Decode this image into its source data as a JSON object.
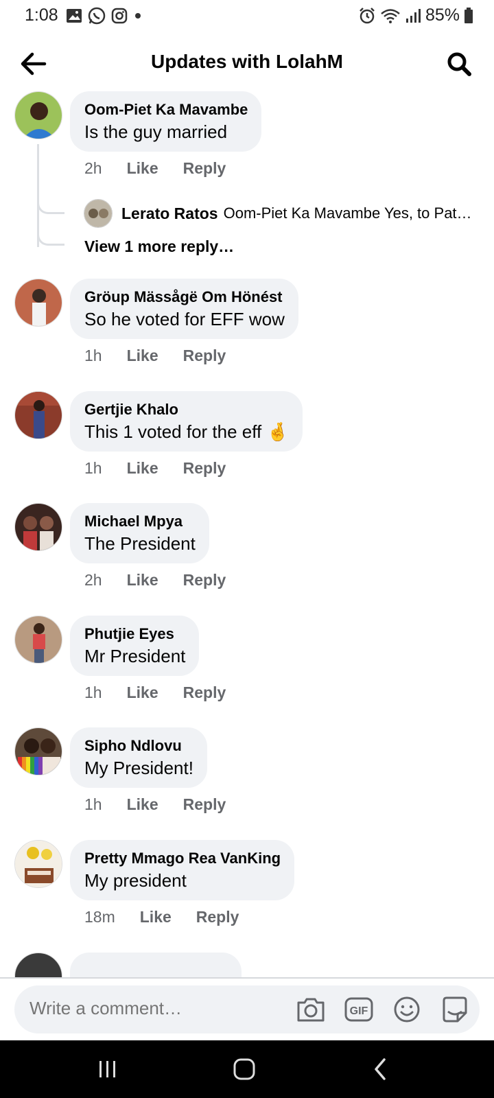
{
  "status": {
    "time": "1:08",
    "battery": "85%"
  },
  "header": {
    "title": "Updates with LolahM"
  },
  "actions": {
    "like": "Like",
    "reply": "Reply"
  },
  "comments": [
    {
      "name": "Oom-Piet Ka Mavambe",
      "text": "Is the guy married",
      "time": "2h",
      "avatar_color": "#6fa8d8",
      "replies": {
        "name": "Lerato Ratos",
        "text": "Oom-Piet Ka Mavambe Yes, to Pat…",
        "view_more": "View 1 more reply…"
      }
    },
    {
      "name": "Gröup Mässågë Om Hönést",
      "text": "So he voted for EFF wow",
      "time": "1h",
      "avatar_color": "#c0674a"
    },
    {
      "name": "Gertjie Khalo",
      "text": "This 1 voted for the eff 🤞",
      "time": "1h",
      "avatar_color": "#7a3b2e"
    },
    {
      "name": "Michael Mpya",
      "text": "The President",
      "time": "2h",
      "avatar_color": "#4a2a22"
    },
    {
      "name": "Phutjie Eyes",
      "text": "Mr President",
      "time": "1h",
      "avatar_color": "#a3684e"
    },
    {
      "name": "Sipho Ndlovu",
      "text": "My President!",
      "time": "1h",
      "avatar_color": "#5e4a3a"
    },
    {
      "name": "Pretty Mmago Rea VanKing",
      "text": "My president",
      "time": "18m",
      "avatar_color": "#c9a227"
    }
  ],
  "composer": {
    "placeholder": "Write a comment…"
  }
}
